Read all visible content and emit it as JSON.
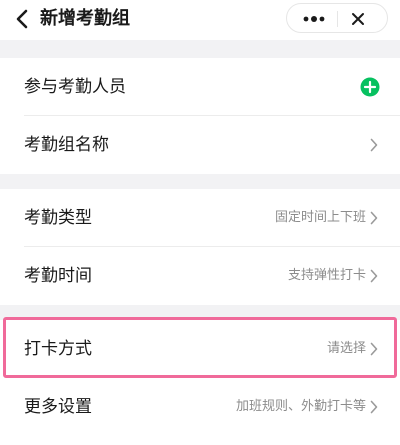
{
  "header": {
    "title": "新增考勤组",
    "back_icon": "chevron-left-icon",
    "more_icon": "more-dots-icon",
    "close_icon": "close-icon"
  },
  "groups": [
    {
      "rows": [
        {
          "label": "参与考勤人员",
          "value": "",
          "trailing_icon": "add-circle-icon",
          "icon_color": "#07c160"
        },
        {
          "label": "考勤组名称",
          "value": "",
          "trailing_icon": "chevron-right-icon"
        }
      ]
    },
    {
      "rows": [
        {
          "label": "考勤类型",
          "value": "固定时间上下班",
          "trailing_icon": "chevron-right-icon"
        },
        {
          "label": "考勤时间",
          "value": "支持弹性打卡",
          "trailing_icon": "chevron-right-icon"
        }
      ]
    },
    {
      "rows": [
        {
          "label": "打卡方式",
          "value": "请选择",
          "trailing_icon": "chevron-right-icon",
          "highlighted": true
        },
        {
          "label": "更多设置",
          "value": "加班规则、外勤打卡等",
          "trailing_icon": "chevron-right-icon"
        }
      ]
    }
  ],
  "colors": {
    "accent_green": "#07c160",
    "highlight_pink": "#f06a9a",
    "page_bg": "#f2f2f4"
  }
}
